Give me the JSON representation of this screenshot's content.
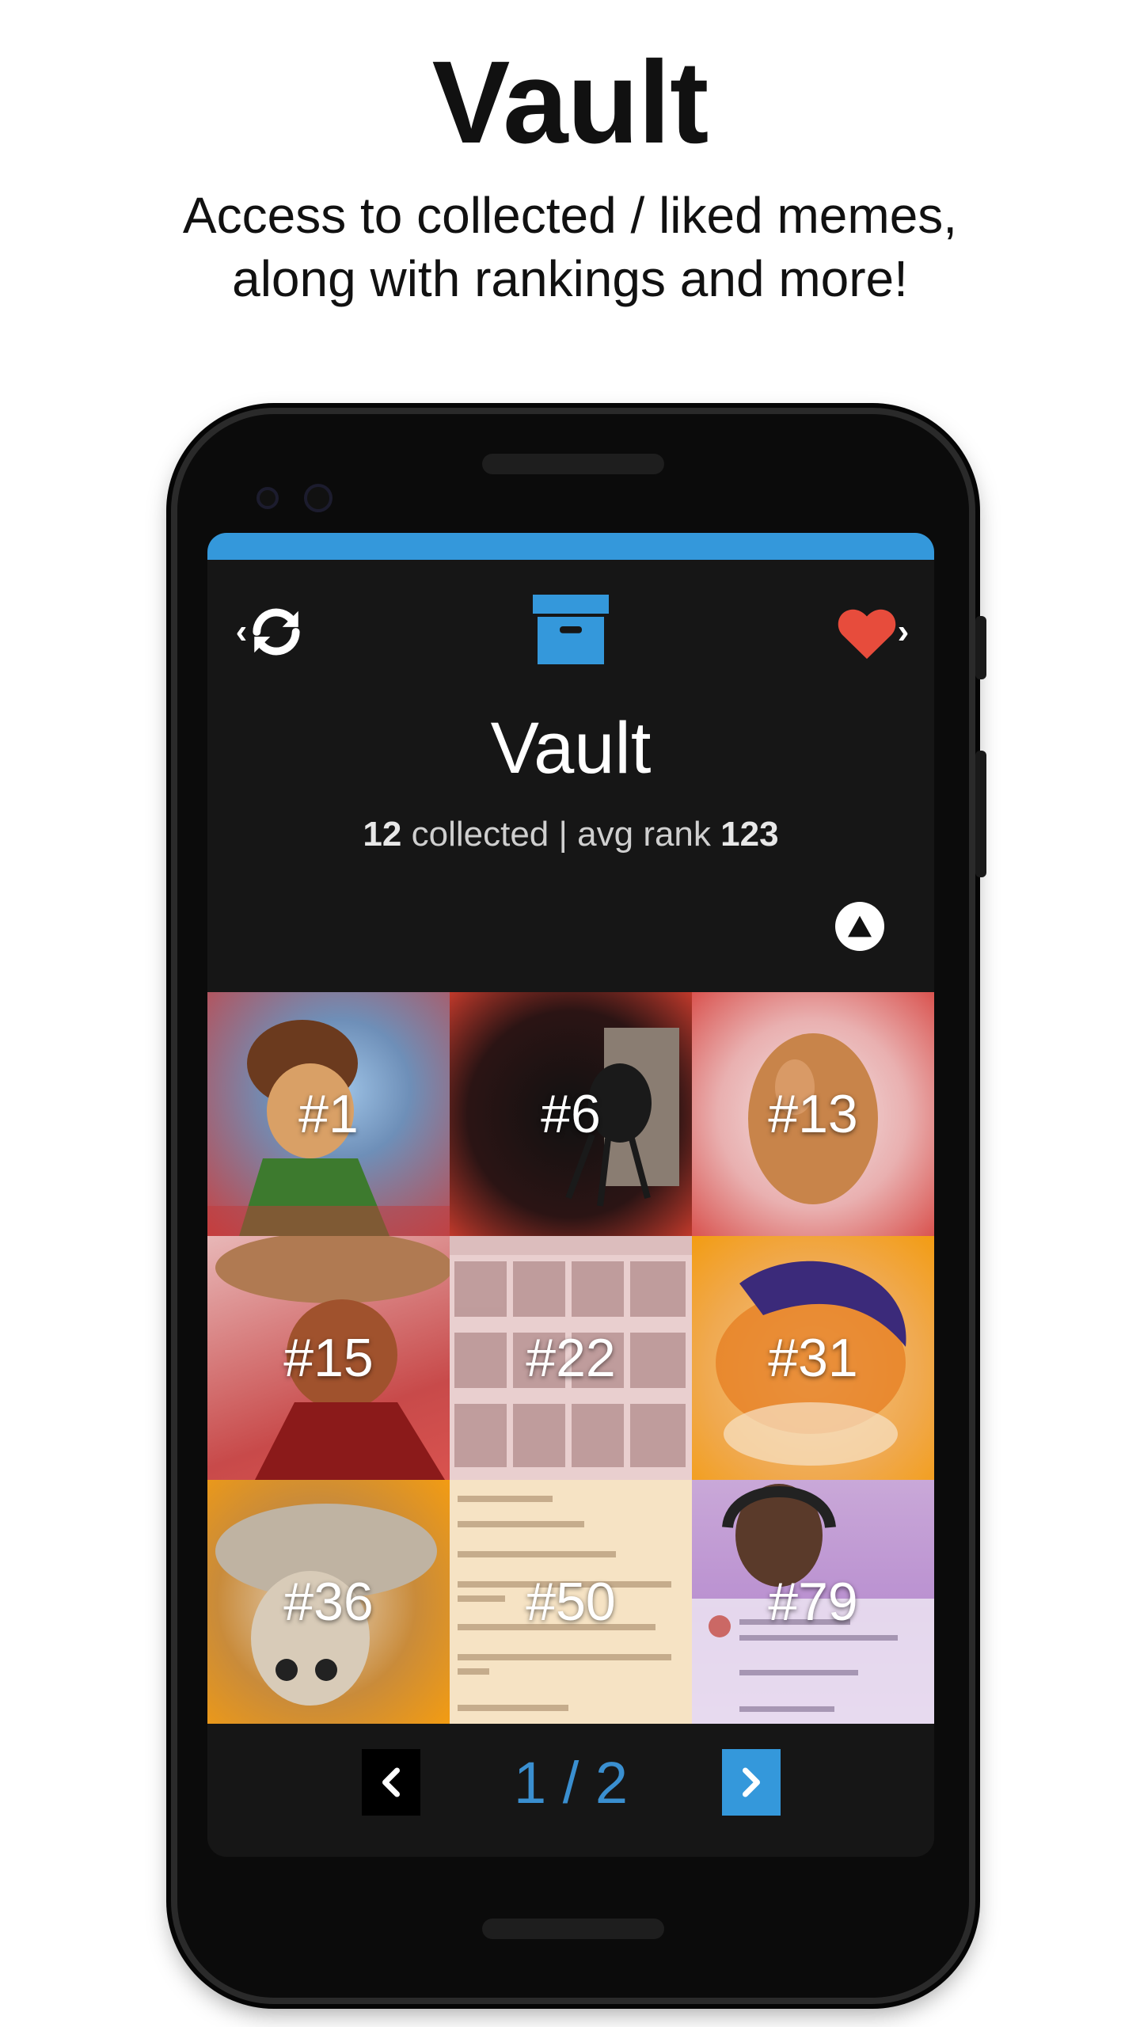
{
  "promo": {
    "title": "Vault",
    "subtitle_line1": "Access to collected / liked memes,",
    "subtitle_line2": "along with rankings and more!"
  },
  "header": {
    "left_icon": "refresh-icon",
    "center_icon": "archive-box-icon",
    "right_icon": "heart-icon",
    "title": "Vault",
    "collected_count": "12",
    "collected_label": "collected | avg rank",
    "avg_rank": "123"
  },
  "grid": {
    "tiles": [
      {
        "rank": "#1"
      },
      {
        "rank": "#6"
      },
      {
        "rank": "#13"
      },
      {
        "rank": "#15"
      },
      {
        "rank": "#22"
      },
      {
        "rank": "#31"
      },
      {
        "rank": "#36"
      },
      {
        "rank": "#50"
      },
      {
        "rank": "#79"
      }
    ]
  },
  "pagination": {
    "current": "1",
    "separator": "/",
    "total": "2",
    "label": "1 / 2"
  },
  "colors": {
    "accent": "#3498db",
    "heart": "#e74c3c",
    "screen_bg": "#161616"
  }
}
